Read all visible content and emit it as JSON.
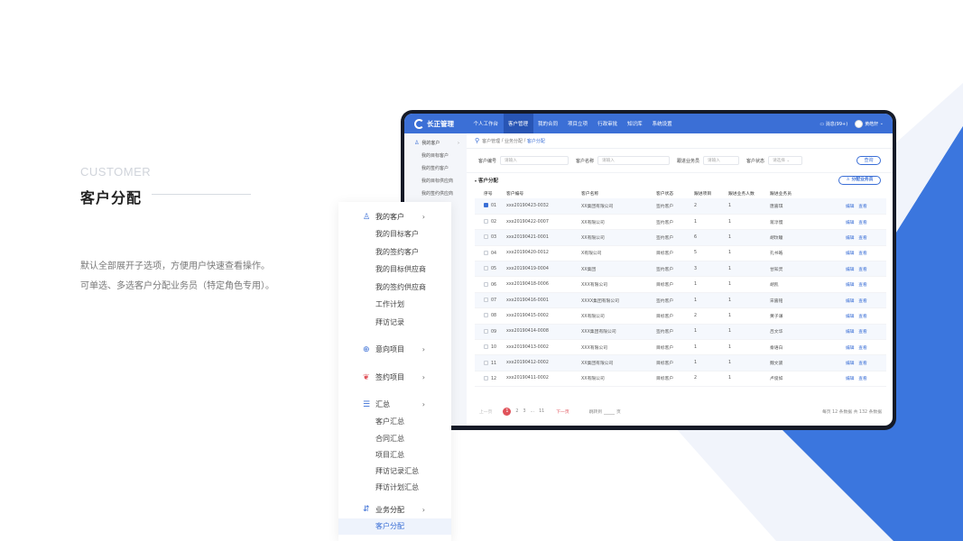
{
  "left": {
    "en_title": "CUSTOMER",
    "zh_title": "客户分配",
    "desc_line1": "默认全部展开子选项，方便用户快速查看操作。",
    "desc_line2": "可单选、多选客户分配业务员（特定角色专用）。"
  },
  "app": {
    "logo": "长正管理",
    "nav": [
      "个人工作台",
      "客户管理",
      "我的合同",
      "项目立项",
      "行政审批",
      "知识库",
      "系统设置"
    ],
    "messages": "消息(99+)",
    "user": "黄皓轩",
    "breadcrumb": {
      "a": "客户管理",
      "b": "业务分配",
      "c": "客户分配"
    },
    "sidebar": {
      "group": "我的客户",
      "items": [
        "我的目标客户",
        "我的签约客户",
        "我的目标供应商",
        "我的签约供应商"
      ]
    },
    "filters": {
      "f1_label": "客户编号",
      "f1_ph": "请输入",
      "f2_label": "客户名称",
      "f2_ph": "请输入",
      "f3_label": "跟进业务员",
      "f3_ph": "请输入",
      "f4_label": "客户状态",
      "f4_ph": "请选择",
      "search": "查询"
    },
    "section_title": "客户分配",
    "assign_button": "分配业务员",
    "columns": [
      "序号",
      "客户编号",
      "客户名称",
      "客户状态",
      "跟进项目",
      "跟进业务人数",
      "跟进业务员"
    ],
    "op_edit": "编辑",
    "op_view": "查看",
    "rows": [
      {
        "n": "01",
        "code": "xxx20190423-0032",
        "name": "XX集团有限公司",
        "status": "签约客户",
        "proj": "2",
        "cnt": "1",
        "rep": "唐嘉琪",
        "checked": true
      },
      {
        "n": "02",
        "code": "xxx20190422-0007",
        "name": "XX有限公司",
        "status": "签约客户",
        "proj": "1",
        "cnt": "1",
        "rep": "蒋淳慢",
        "checked": false
      },
      {
        "n": "03",
        "code": "xxx20190421-0001",
        "name": "XX有限公司",
        "status": "签约客户",
        "proj": "6",
        "cnt": "1",
        "rep": "胡玟瞳",
        "checked": false
      },
      {
        "n": "04",
        "code": "xxx20190420-0012",
        "name": "X有限公司",
        "status": "目标客户",
        "proj": "5",
        "cnt": "1",
        "rep": "孔书皓",
        "checked": false
      },
      {
        "n": "05",
        "code": "xxx20190419-0004",
        "name": "XX集团",
        "status": "签约客户",
        "proj": "3",
        "cnt": "1",
        "rep": "甘知灵",
        "checked": false
      },
      {
        "n": "06",
        "code": "xxx20190418-0006",
        "name": "XXX有限公司",
        "status": "目标客户",
        "proj": "1",
        "cnt": "1",
        "rep": "胡凯",
        "checked": false
      },
      {
        "n": "07",
        "code": "xxx20190416-0001",
        "name": "XXXX集团有限公司",
        "status": "签约客户",
        "proj": "1",
        "cnt": "1",
        "rep": "宋嘉铭",
        "checked": false
      },
      {
        "n": "08",
        "code": "xxx20190415-0002",
        "name": "XX有限公司",
        "status": "目标客户",
        "proj": "2",
        "cnt": "1",
        "rep": "黄子谦",
        "checked": false
      },
      {
        "n": "09",
        "code": "xxx20190414-0008",
        "name": "XXX集团有限公司",
        "status": "签约客户",
        "proj": "1",
        "cnt": "1",
        "rep": "吕文华",
        "checked": false
      },
      {
        "n": "10",
        "code": "xxx20190413-0002",
        "name": "XXX有限公司",
        "status": "目标客户",
        "proj": "1",
        "cnt": "1",
        "rep": "秦语白",
        "checked": false
      },
      {
        "n": "11",
        "code": "xxx20190412-0002",
        "name": "XX集团有限公司",
        "status": "目标客户",
        "proj": "1",
        "cnt": "1",
        "rep": "魏文骏",
        "checked": false
      },
      {
        "n": "12",
        "code": "xxx20190411-0002",
        "name": "XX有限公司",
        "status": "目标客户",
        "proj": "2",
        "cnt": "1",
        "rep": "卢俊如",
        "checked": false
      }
    ],
    "pager": {
      "prev": "上一页",
      "p1": "1",
      "p2": "2",
      "p3": "3",
      "dots": "...",
      "p11": "11",
      "next": "下一页",
      "goto": "跳转到",
      "page_unit": "页",
      "total": "每页 12 条数据   共 132 条数据"
    }
  },
  "menu": {
    "g1": "我的客户",
    "g1_items": [
      "我的目标客户",
      "我的签约客户",
      "我的目标供应商",
      "我的签约供应商",
      "工作计划",
      "拜访记录"
    ],
    "g2": "意向项目",
    "g3": "签约项目",
    "g4": "汇总",
    "g4_items": [
      "客户汇总",
      "合同汇总",
      "项目汇总",
      "拜访记录汇总",
      "拜访计划汇总"
    ],
    "g5": "业务分配",
    "g5_items": [
      "客户分配"
    ]
  },
  "colors": {
    "accent": "#3b6fd6",
    "danger": "#e0525a"
  }
}
